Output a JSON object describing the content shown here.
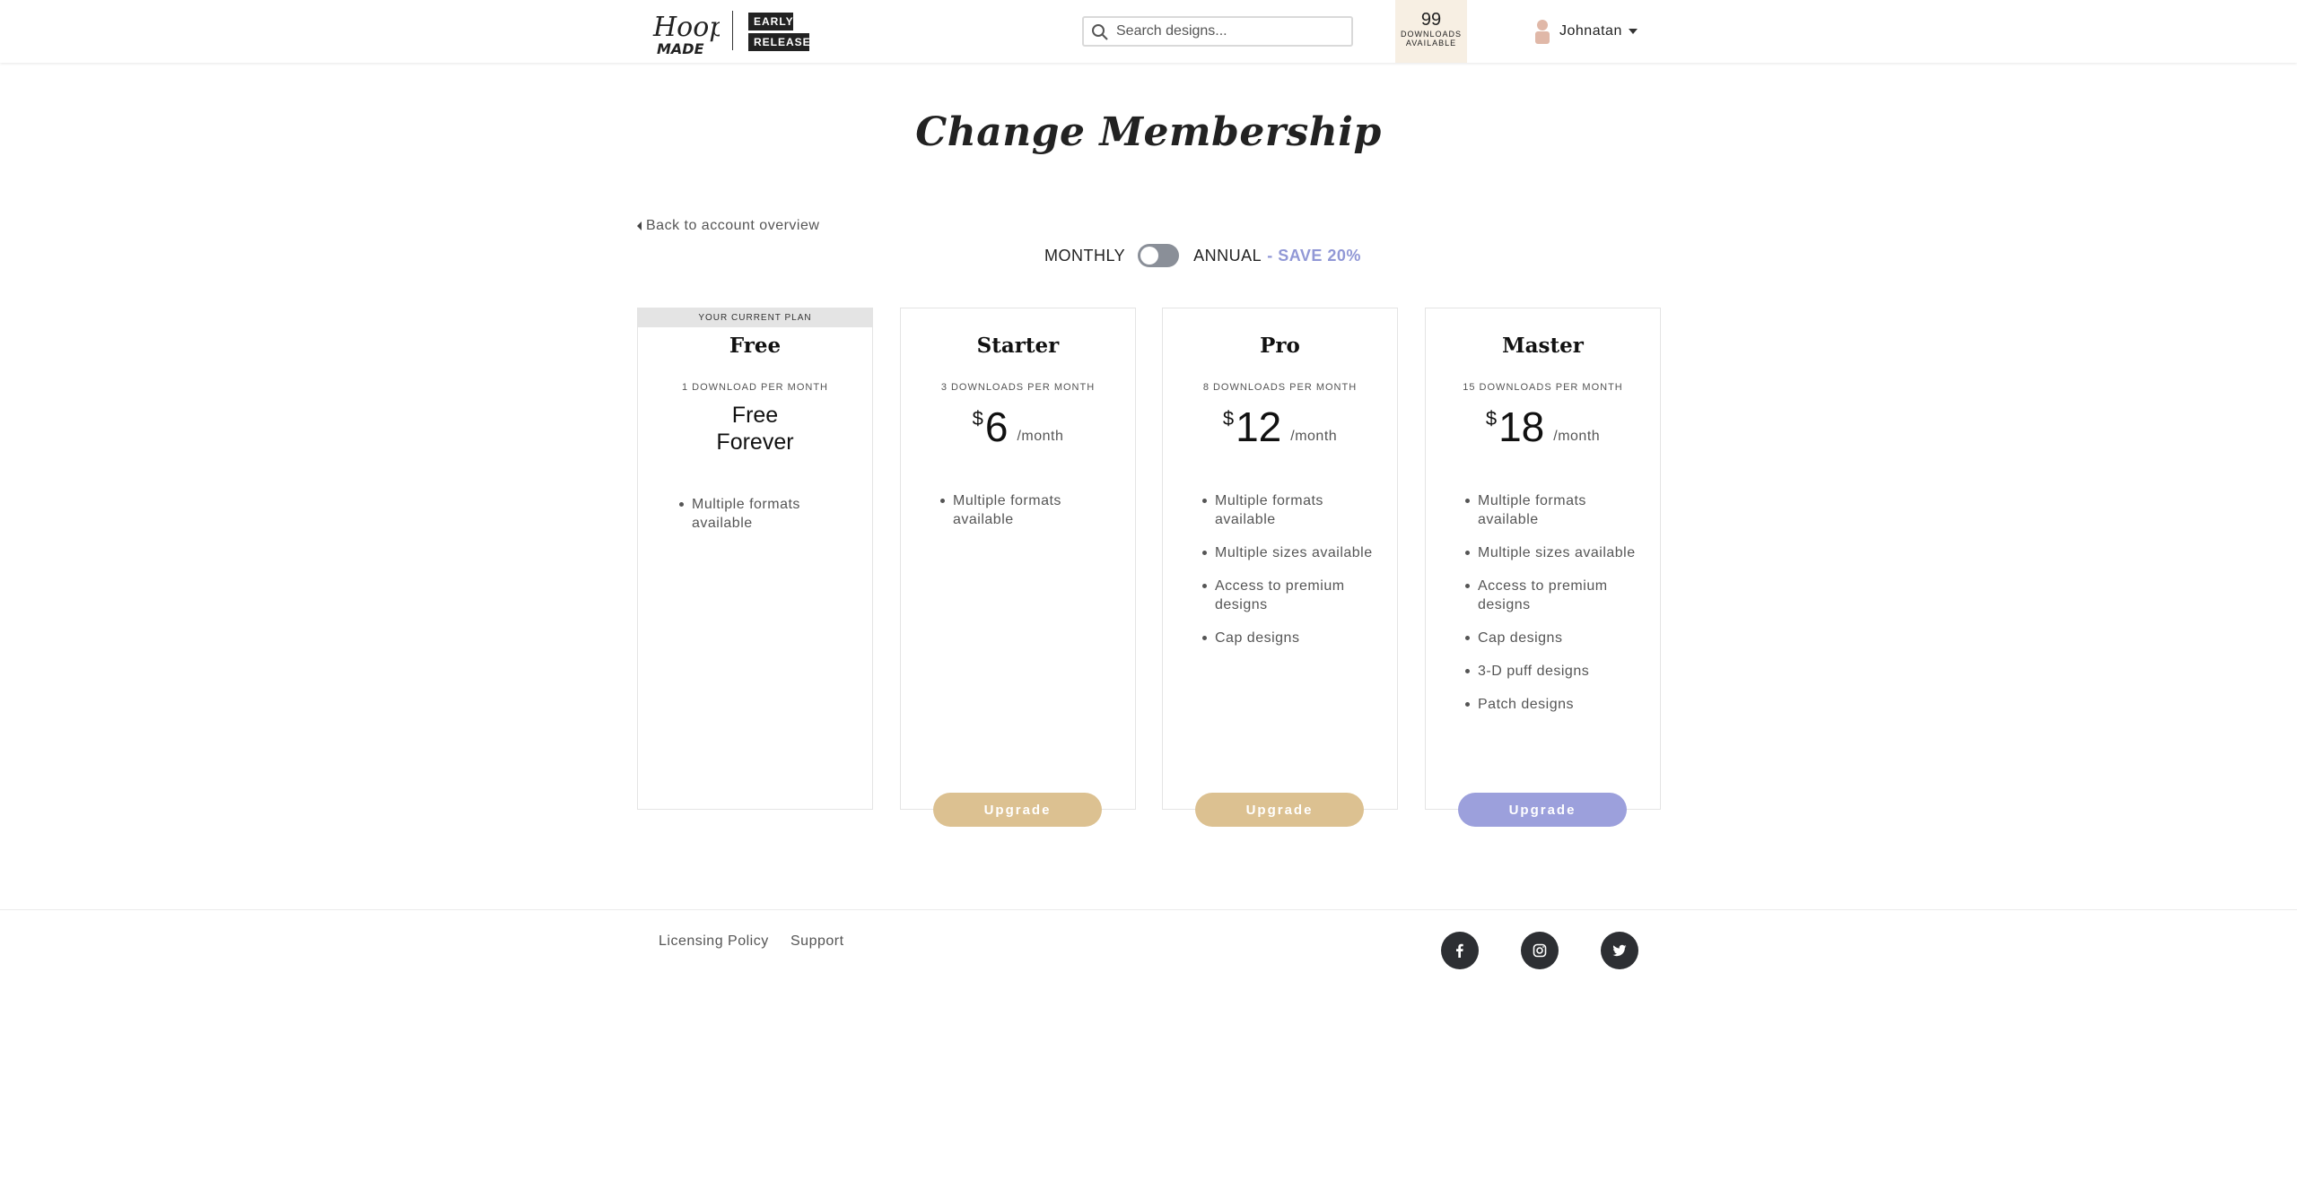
{
  "header": {
    "logo_text": "Hoop MADE",
    "badge_early": "EARLY",
    "badge_release": "RELEASE",
    "search_placeholder": "Search designs...",
    "downloads_count": "99",
    "downloads_label_1": "DOWNLOADS",
    "downloads_label_2": "AVAILABLE",
    "user_name": "Johnatan"
  },
  "page": {
    "title": "Change Membership",
    "back_link": "Back to account overview"
  },
  "billing": {
    "monthly_label": "MONTHLY",
    "annual_label": "ANNUAL",
    "save_label": "- SAVE 20%",
    "annual_selected": false
  },
  "plans": [
    {
      "current_tag": "YOUR CURRENT PLAN",
      "name": "Free",
      "downloads": "1 DOWNLOAD PER MONTH",
      "price_line_1": "Free",
      "price_line_2": "Forever",
      "features": [
        "Multiple formats available"
      ]
    },
    {
      "name": "Starter",
      "downloads": "3 DOWNLOADS PER MONTH",
      "currency": "$",
      "price": "6",
      "period": "/month",
      "features": [
        "Multiple formats available"
      ],
      "button": "Upgrade"
    },
    {
      "name": "Pro",
      "downloads": "8 DOWNLOADS PER MONTH",
      "currency": "$",
      "price": "12",
      "period": "/month",
      "features": [
        "Multiple formats available",
        "Multiple sizes available",
        "Access to premium designs",
        "Cap designs"
      ],
      "button": "Upgrade"
    },
    {
      "name": "Master",
      "downloads": "15 DOWNLOADS PER MONTH",
      "currency": "$",
      "price": "18",
      "period": "/month",
      "features": [
        "Multiple formats available",
        "Multiple sizes available",
        "Access to premium designs",
        "Cap designs",
        "3-D puff designs",
        "Patch designs"
      ],
      "button": "Upgrade"
    }
  ],
  "footer": {
    "links": [
      "Licensing Policy",
      "Support"
    ],
    "social": [
      "facebook-icon",
      "instagram-icon",
      "twitter-icon"
    ]
  },
  "colors": {
    "gold_button": "#dcc191",
    "purple_button": "#9ca0dc",
    "save_accent": "#9198d6",
    "downloads_bg": "#f7efe3"
  }
}
